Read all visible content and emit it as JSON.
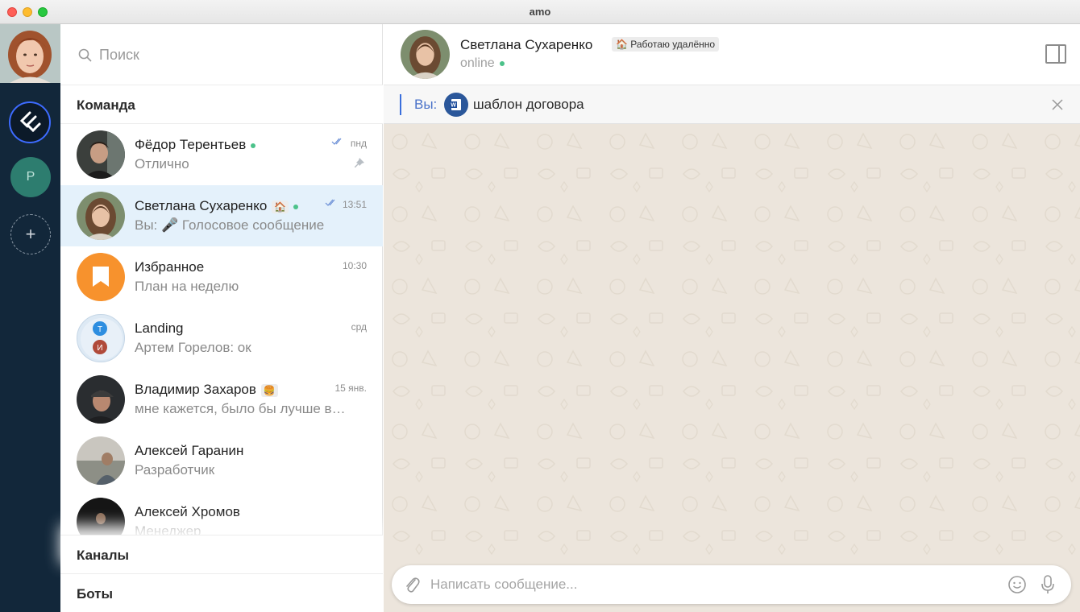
{
  "window": {
    "title": "amo"
  },
  "search": {
    "placeholder": "Поиск"
  },
  "sections": {
    "team": "Команда",
    "channels": "Каналы",
    "bots": "Боты"
  },
  "rail": {
    "workspace_letter": "P",
    "add_label": "+"
  },
  "chats": [
    {
      "name": "Фёдор Терентьев",
      "subtitle": "Отлично",
      "time": "пнд",
      "online": true,
      "read": true,
      "pinned": true,
      "avatar": "dark-man"
    },
    {
      "name": "Светлана Сухаренко",
      "subtitle": "Вы: 🎤 Голосовое сообщение",
      "time": "13:51",
      "online": true,
      "read": true,
      "status_emoji": "🏠",
      "active": true,
      "avatar": "woman"
    },
    {
      "name": "Избранное",
      "subtitle": "План на неделю",
      "time": "10:30",
      "avatar": "bookmark"
    },
    {
      "name": "Landing",
      "subtitle": "Артем Горелов: ок",
      "time": "срд",
      "avatar": "group",
      "group_letters": [
        "Т",
        "И"
      ]
    },
    {
      "name": "Владимир Захаров",
      "subtitle": "мне кажется, было бы лучше в…",
      "time": "15 янв.",
      "status_emoji": "🍔",
      "avatar": "man-cap"
    },
    {
      "name": "Алексей Гаранин",
      "subtitle": "Разработчик",
      "time": "",
      "avatar": "landscape"
    },
    {
      "name": "Алексей Хромов",
      "subtitle": "Менеджер",
      "time": "",
      "avatar": "dark-man"
    }
  ],
  "conversation": {
    "name": "Светлана Сухаренко",
    "status_badge": "🏠 Работаю удалённо",
    "presence": "online",
    "pinned_prefix": "Вы:",
    "pinned_text": "шаблон договора",
    "composer_placeholder": "Написать сообщение..."
  },
  "colors": {
    "rail_bg": "#12273a",
    "accent": "#3a6fdc",
    "active_row": "#e4f1fb",
    "chat_bg": "#ece5dc",
    "online": "#4cc28a",
    "favorites": "#f7922d"
  }
}
